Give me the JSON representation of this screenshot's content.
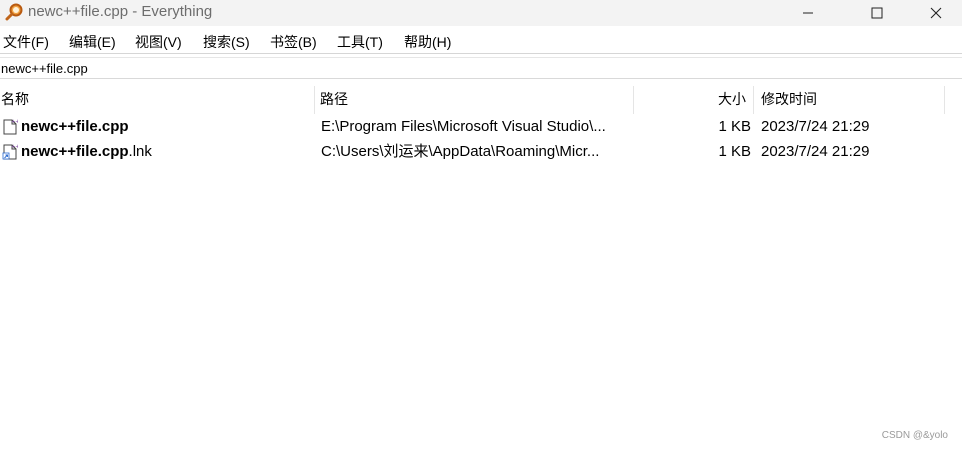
{
  "window": {
    "title": "newc++file.cpp - Everything",
    "app_icon": "magnifier-icon",
    "controls": [
      "minimize-icon",
      "maximize-icon",
      "close-icon"
    ]
  },
  "menu": {
    "items": [
      {
        "label": "文件(F)"
      },
      {
        "label": "编辑(E)"
      },
      {
        "label": "视图(V)"
      },
      {
        "label": "搜索(S)"
      },
      {
        "label": "书签(B)"
      },
      {
        "label": "工具(T)"
      },
      {
        "label": "帮助(H)"
      }
    ]
  },
  "search": {
    "value": "newc++file.cpp"
  },
  "columns": {
    "name": "名称",
    "path": "路径",
    "size": "大小",
    "modified": "修改时间"
  },
  "results": [
    {
      "name_bold": "newc++file.cpp",
      "name_rest": "",
      "icon": "cpp-file-icon",
      "path": "E:\\Program Files\\Microsoft Visual Studio\\...",
      "size": "1 KB",
      "modified": "2023/7/24 21:29"
    },
    {
      "name_bold": "newc++file.cpp",
      "name_rest": ".lnk",
      "icon": "shortcut-file-icon",
      "path": "C:\\Users\\刘运来\\AppData\\Roaming\\Micr...",
      "size": "1 KB",
      "modified": "2023/7/24 21:29"
    }
  ],
  "watermark": "CSDN @&yolo",
  "colors": {
    "app_icon": "#d9731c",
    "title_text": "#6d6d6d"
  }
}
